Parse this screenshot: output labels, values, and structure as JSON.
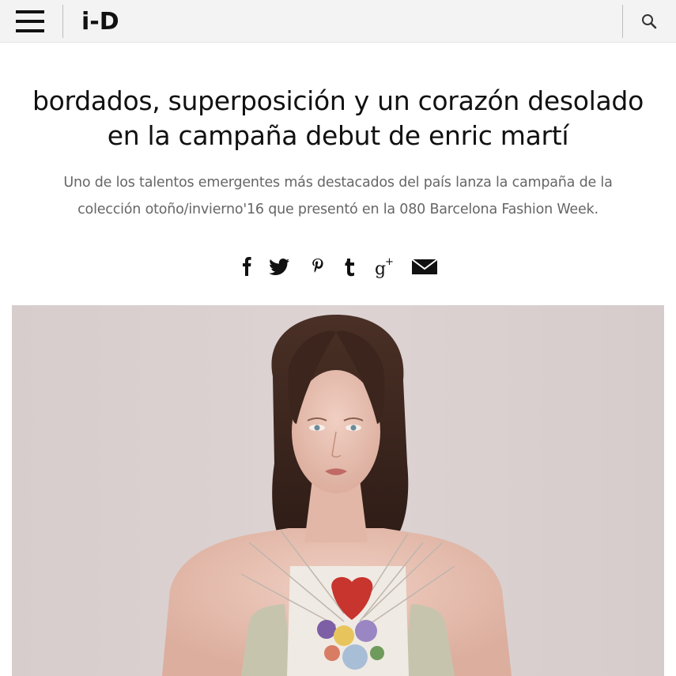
{
  "header": {
    "logo_text": "i-D",
    "menu_icon": "hamburger-menu-icon",
    "search_icon": "search-icon"
  },
  "article": {
    "headline_line1": "bordados, superposición y un corazón desolado",
    "headline_line2": "en la campaña debut de enric martí",
    "dek_line1": "Uno de los talentos emergentes más destacados del país lanza la campaña de la",
    "dek_line2": "colección otoño/invierno'16 que presentó en la 080 Barcelona Fashion Week."
  },
  "share": {
    "icons": [
      "facebook-icon",
      "twitter-icon",
      "pinterest-icon",
      "tumblr-icon",
      "google-plus-icon",
      "email-icon"
    ]
  },
  "colors": {
    "header_bg": "#f3f3f3",
    "text": "#111111",
    "dek_text": "#666666",
    "photo_bg": "#d9cfcf"
  }
}
